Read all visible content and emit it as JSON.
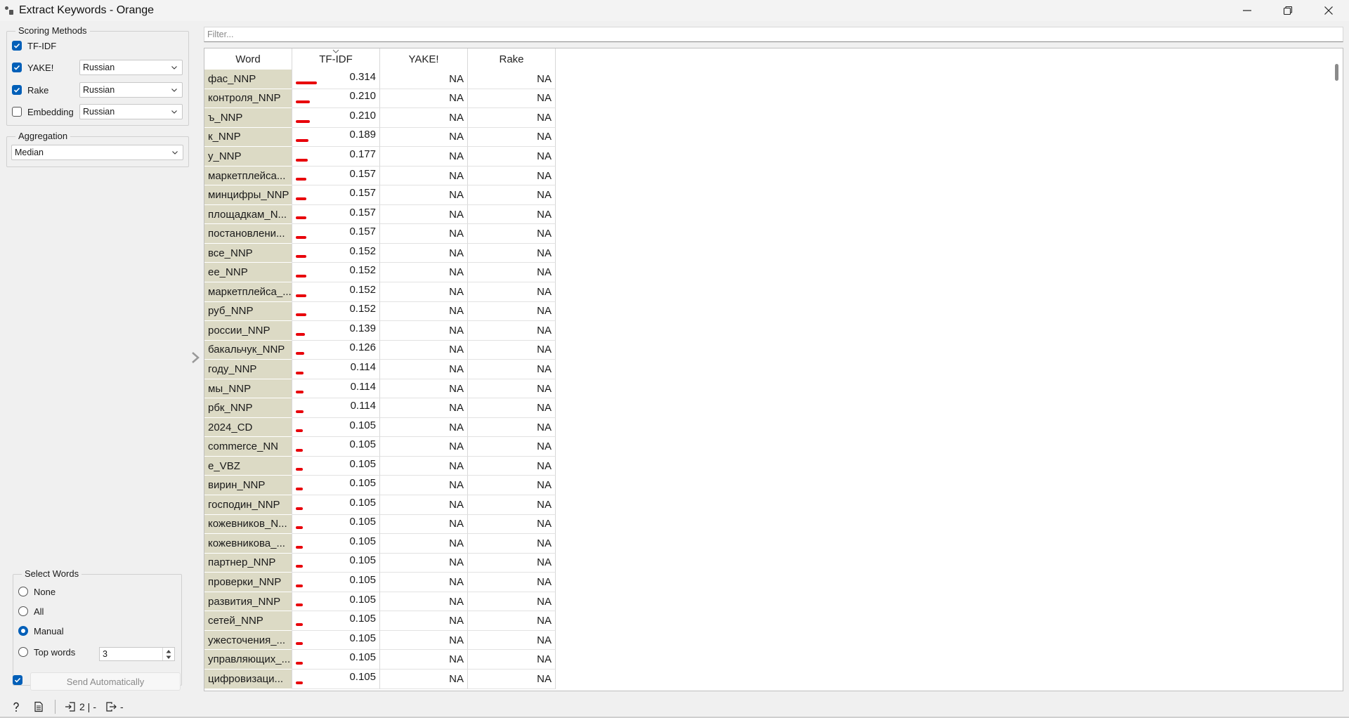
{
  "window": {
    "title": "Extract Keywords - Orange"
  },
  "scoring": {
    "legend": "Scoring Methods",
    "methods": [
      {
        "label": "TF-IDF",
        "checked": true,
        "language": null
      },
      {
        "label": "YAKE!",
        "checked": true,
        "language": "Russian"
      },
      {
        "label": "Rake",
        "checked": true,
        "language": "Russian"
      },
      {
        "label": "Embedding",
        "checked": false,
        "language": "Russian"
      }
    ]
  },
  "aggregation": {
    "legend": "Aggregation",
    "value": "Median"
  },
  "select_words": {
    "legend": "Select Words",
    "options": [
      "None",
      "All",
      "Manual",
      "Top words"
    ],
    "selected": "Manual",
    "top_words_value": "3"
  },
  "send": {
    "label": "Send Automatically",
    "checked": true
  },
  "filter": {
    "placeholder": "Filter..."
  },
  "table": {
    "headers": [
      "Word",
      "TF-IDF",
      "YAKE!",
      "Rake"
    ],
    "sort_column": "TF-IDF",
    "rows": [
      {
        "word": "фас_NNP",
        "tfidf": "0.314",
        "yake": "NA",
        "rake": "NA"
      },
      {
        "word": "контроля_NNP",
        "tfidf": "0.210",
        "yake": "NA",
        "rake": "NA"
      },
      {
        "word": "ъ_NNP",
        "tfidf": "0.210",
        "yake": "NA",
        "rake": "NA"
      },
      {
        "word": "к_NNP",
        "tfidf": "0.189",
        "yake": "NA",
        "rake": "NA"
      },
      {
        "word": "у_NNP",
        "tfidf": "0.177",
        "yake": "NA",
        "rake": "NA"
      },
      {
        "word": "маркетплейса...",
        "tfidf": "0.157",
        "yake": "NA",
        "rake": "NA"
      },
      {
        "word": "минцифры_NNP",
        "tfidf": "0.157",
        "yake": "NA",
        "rake": "NA"
      },
      {
        "word": "площадкам_N...",
        "tfidf": "0.157",
        "yake": "NA",
        "rake": "NA"
      },
      {
        "word": "постановлени...",
        "tfidf": "0.157",
        "yake": "NA",
        "rake": "NA"
      },
      {
        "word": "все_NNP",
        "tfidf": "0.152",
        "yake": "NA",
        "rake": "NA"
      },
      {
        "word": "ее_NNP",
        "tfidf": "0.152",
        "yake": "NA",
        "rake": "NA"
      },
      {
        "word": "маркетплейса_...",
        "tfidf": "0.152",
        "yake": "NA",
        "rake": "NA"
      },
      {
        "word": "руб_NNP",
        "tfidf": "0.152",
        "yake": "NA",
        "rake": "NA"
      },
      {
        "word": "россии_NNP",
        "tfidf": "0.139",
        "yake": "NA",
        "rake": "NA"
      },
      {
        "word": "бакальчук_NNP",
        "tfidf": "0.126",
        "yake": "NA",
        "rake": "NA"
      },
      {
        "word": "году_NNP",
        "tfidf": "0.114",
        "yake": "NA",
        "rake": "NA"
      },
      {
        "word": "мы_NNP",
        "tfidf": "0.114",
        "yake": "NA",
        "rake": "NA"
      },
      {
        "word": "рбк_NNP",
        "tfidf": "0.114",
        "yake": "NA",
        "rake": "NA"
      },
      {
        "word": "2024_CD",
        "tfidf": "0.105",
        "yake": "NA",
        "rake": "NA"
      },
      {
        "word": "commerce_NN",
        "tfidf": "0.105",
        "yake": "NA",
        "rake": "NA"
      },
      {
        "word": "e_VBZ",
        "tfidf": "0.105",
        "yake": "NA",
        "rake": "NA"
      },
      {
        "word": "вирин_NNP",
        "tfidf": "0.105",
        "yake": "NA",
        "rake": "NA"
      },
      {
        "word": "господин_NNP",
        "tfidf": "0.105",
        "yake": "NA",
        "rake": "NA"
      },
      {
        "word": "кожевников_N...",
        "tfidf": "0.105",
        "yake": "NA",
        "rake": "NA"
      },
      {
        "word": "кожевникова_...",
        "tfidf": "0.105",
        "yake": "NA",
        "rake": "NA"
      },
      {
        "word": "партнер_NNP",
        "tfidf": "0.105",
        "yake": "NA",
        "rake": "NA"
      },
      {
        "word": "проверки_NNP",
        "tfidf": "0.105",
        "yake": "NA",
        "rake": "NA"
      },
      {
        "word": "развития_NNP",
        "tfidf": "0.105",
        "yake": "NA",
        "rake": "NA"
      },
      {
        "word": "сетей_NNP",
        "tfidf": "0.105",
        "yake": "NA",
        "rake": "NA"
      },
      {
        "word": "ужесточения_...",
        "tfidf": "0.105",
        "yake": "NA",
        "rake": "NA"
      },
      {
        "word": "управляющих_...",
        "tfidf": "0.105",
        "yake": "NA",
        "rake": "NA"
      },
      {
        "word": "цифровизаци...",
        "tfidf": "0.105",
        "yake": "NA",
        "rake": "NA"
      }
    ]
  },
  "status": {
    "input_count": "2 |",
    "input_dash": "-",
    "output_dash": "-"
  },
  "colors": {
    "bar": "#e8000a",
    "word_bg": "#dcdac5",
    "accent": "#005fb8"
  }
}
